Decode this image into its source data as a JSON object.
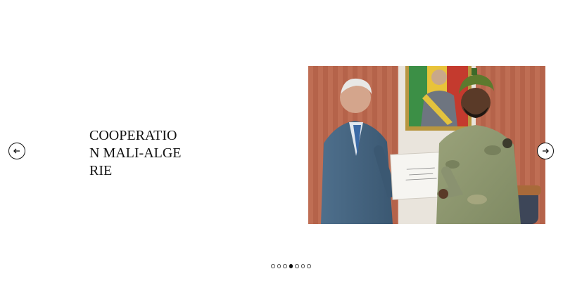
{
  "slide": {
    "title": "COOPERATION MALI-ALGERIE",
    "photo_alt": "Two men holding an envelope in front of a framed portrait"
  },
  "navigation": {
    "prev_icon": "arrow-left-icon",
    "next_icon": "arrow-right-icon"
  },
  "pagination": {
    "total": 7,
    "active_index": 3
  },
  "colors": {
    "background": "#ffffff",
    "text": "#111111",
    "dot_active": "#111111"
  }
}
